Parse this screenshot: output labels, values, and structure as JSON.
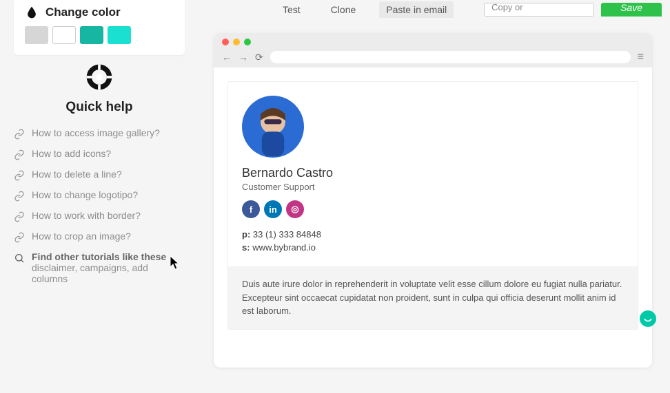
{
  "topbar": {
    "tabs": {
      "test": "Test",
      "clone": "Clone",
      "paste": "Paste in email"
    },
    "copy": "Copy or",
    "save": "Save"
  },
  "colorcard": {
    "title": "Change color",
    "swatches": [
      "#d6d6d6",
      "#ffffff",
      "#17b6a3",
      "#19e0d0"
    ]
  },
  "help": {
    "title": "Quick help",
    "links": [
      "How to access image gallery?",
      "How to add icons?",
      "How to delete a line?",
      "How to change logotipo?",
      "How to work with border?",
      "How to crop an image?"
    ],
    "search_main": "Find other tutorials like these",
    "search_sub": "disclaimer, campaigns, add columns"
  },
  "signature": {
    "name": "Bernardo Castro",
    "role": "Customer Support",
    "phone_label": "p:",
    "phone": "33 (1) 333 84848",
    "site_label": "s:",
    "site": "www.bybrand.io",
    "disclaimer": "Duis aute irure dolor in reprehenderit in voluptate velit esse cillum dolore eu fugiat nulla pariatur. Excepteur sint occaecat cupidatat non proident, sunt in culpa qui officia deserunt mollit anim id est laborum."
  }
}
